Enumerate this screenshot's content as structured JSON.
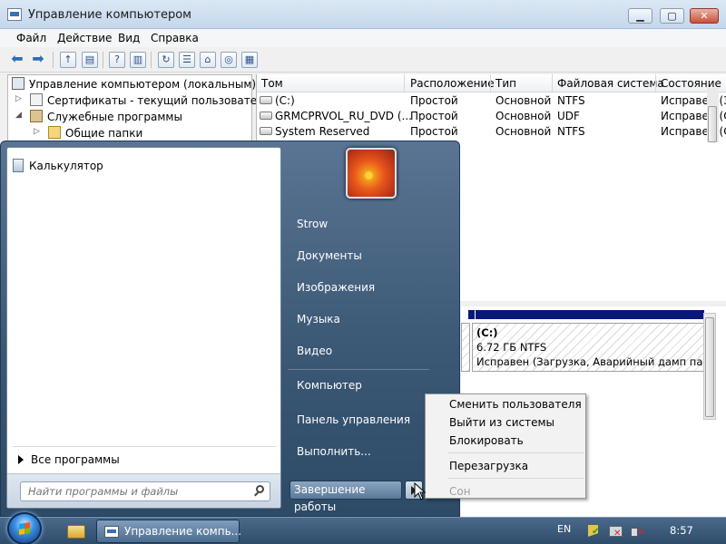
{
  "window": {
    "title": "Управление компьютером",
    "menu": [
      "Файл",
      "Действие",
      "Вид",
      "Справка"
    ]
  },
  "tree": {
    "root": "Управление компьютером (локальным)",
    "items": [
      {
        "label": "Сертификаты - текущий пользователь"
      },
      {
        "label": "Служебные программы"
      },
      {
        "label": "Общие папки"
      }
    ]
  },
  "volumes": {
    "columns": [
      "Том",
      "Расположение",
      "Тип",
      "Файловая система",
      "Состояние"
    ],
    "rows": [
      {
        "name": "(C:)",
        "layout": "Простой",
        "type": "Основной",
        "fs": "NTFS",
        "status": "Исправен (З"
      },
      {
        "name": "GRMCPRVOL_RU_DVD (...",
        "layout": "Простой",
        "type": "Основной",
        "fs": "UDF",
        "status": "Исправен (О"
      },
      {
        "name": "System Reserved",
        "layout": "Простой",
        "type": "Основной",
        "fs": "NTFS",
        "status": "Исправен (С"
      }
    ]
  },
  "diskmap": {
    "partition": {
      "name": "(C:)",
      "size": "6.72 ГБ NTFS",
      "status": "Исправен (Загрузка, Аварийный дамп памя"
    }
  },
  "startmenu": {
    "pinned": [
      {
        "label": "Калькулятор"
      }
    ],
    "all_programs": "Все программы",
    "search_placeholder": "Найти программы и файлы",
    "right_links": [
      {
        "label": "Strow"
      },
      {
        "label": "Документы"
      },
      {
        "label": "Изображения"
      },
      {
        "label": "Музыка"
      },
      {
        "label": "Видео"
      },
      {
        "label": "Компьютер"
      },
      {
        "label": "Панель управления"
      },
      {
        "label": "Выполнить..."
      }
    ],
    "shutdown_label": "Завершение работы",
    "submenu": [
      {
        "label": "Сменить пользователя",
        "enabled": true
      },
      {
        "label": "Выйти из системы",
        "enabled": true
      },
      {
        "label": "Блокировать",
        "enabled": true
      },
      {
        "label": "Перезагрузка",
        "enabled": true
      },
      {
        "label": "Сон",
        "enabled": false
      }
    ]
  },
  "taskbar": {
    "task_label": "Управление компь...",
    "language": "EN",
    "clock": "8:57"
  }
}
